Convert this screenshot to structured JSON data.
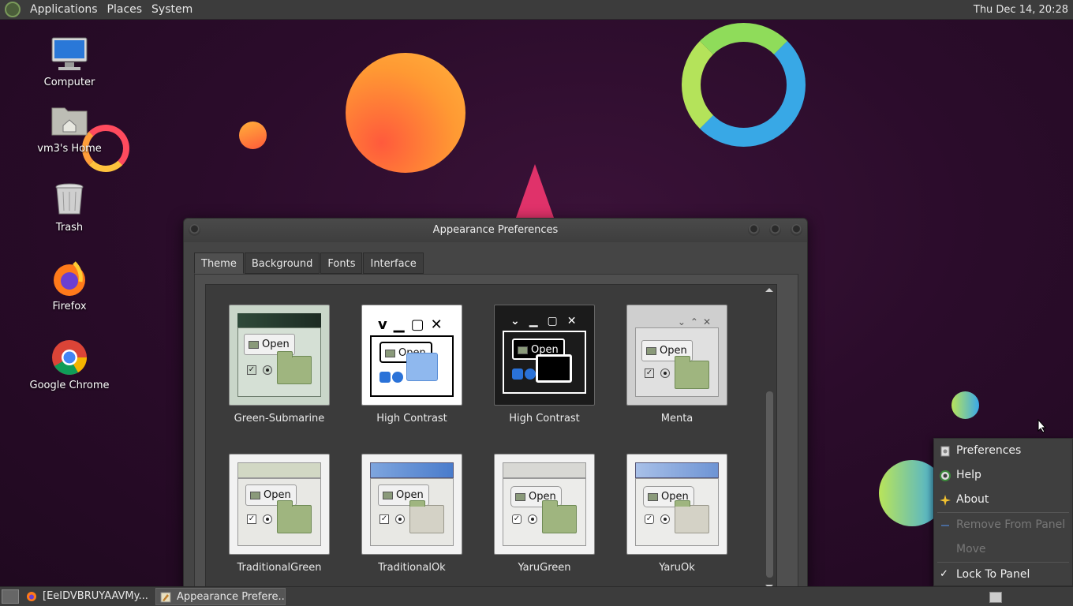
{
  "top_panel": {
    "menus": [
      "Applications",
      "Places",
      "System"
    ],
    "clock": "Thu Dec 14, 20:28"
  },
  "desktop_icons": [
    {
      "label": "Computer",
      "icon": "computer-icon"
    },
    {
      "label": "vm3's Home",
      "icon": "home-folder-icon"
    },
    {
      "label": "Trash",
      "icon": "trash-icon"
    },
    {
      "label": "Firefox",
      "icon": "firefox-icon"
    },
    {
      "label": "Google Chrome",
      "icon": "chrome-icon"
    }
  ],
  "window": {
    "title": "Appearance Preferences",
    "tabs": [
      "Theme",
      "Background",
      "Fonts",
      "Interface"
    ],
    "active_tab": "Theme",
    "themes": [
      {
        "name": "Green-Submarine",
        "open_label": "Open"
      },
      {
        "name": "High Contrast",
        "open_label": "Open"
      },
      {
        "name": "High Contrast",
        "open_label": "Open"
      },
      {
        "name": "Menta",
        "open_label": "Open"
      },
      {
        "name": "TraditionalGreen",
        "open_label": "Open"
      },
      {
        "name": "TraditionalOk",
        "open_label": "Open"
      },
      {
        "name": "YaruGreen",
        "open_label": "Open"
      },
      {
        "name": "YaruOk",
        "open_label": "Open"
      }
    ]
  },
  "context_menu": {
    "items": [
      {
        "label": "Preferences",
        "icon": "preferences-icon",
        "enabled": true
      },
      {
        "label": "Help",
        "icon": "help-icon",
        "enabled": true
      },
      {
        "label": "About",
        "icon": "about-icon",
        "enabled": true
      },
      {
        "label": "Remove From Panel",
        "icon": "remove-icon",
        "enabled": false
      },
      {
        "label": "Move",
        "icon": "",
        "enabled": false
      },
      {
        "label": "Lock To Panel",
        "icon": "check-icon",
        "enabled": true
      }
    ]
  },
  "taskbar": {
    "tasks": [
      {
        "label": "[EeIDVBRUYAAVMy...",
        "icon": "firefox-icon",
        "active": false
      },
      {
        "label": "Appearance Prefere...",
        "icon": "appearance-icon",
        "active": true
      }
    ]
  },
  "colors": {
    "desktop_bg": "#2b0c2b",
    "panel_bg": "#3c3c3c",
    "window_bg": "#454545"
  }
}
